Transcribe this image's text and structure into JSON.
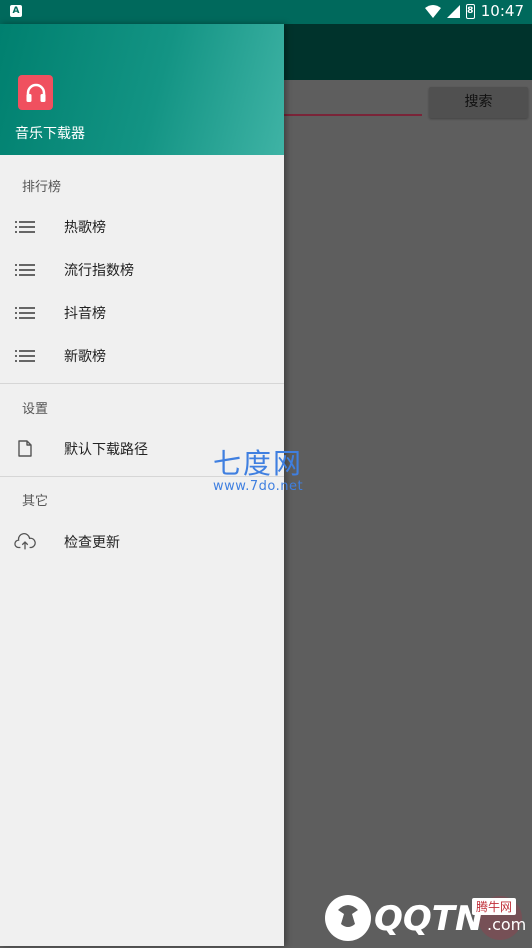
{
  "status_bar": {
    "time": "10:47",
    "battery_text": "8"
  },
  "background": {
    "search_button": "搜索"
  },
  "drawer": {
    "app_name": "音乐下载器",
    "sections": [
      {
        "title": "排行榜",
        "items": [
          {
            "label": "热歌榜",
            "icon": "list-icon"
          },
          {
            "label": "流行指数榜",
            "icon": "list-icon"
          },
          {
            "label": "抖音榜",
            "icon": "list-icon"
          },
          {
            "label": "新歌榜",
            "icon": "list-icon"
          }
        ]
      },
      {
        "title": "设置",
        "items": [
          {
            "label": "默认下载路径",
            "icon": "file-icon"
          }
        ]
      },
      {
        "title": "其它",
        "items": [
          {
            "label": "检查更新",
            "icon": "cloud-upload-icon"
          }
        ]
      }
    ]
  },
  "watermark": {
    "title": "七度网",
    "url": "www.7do.net"
  },
  "corner_badge": {
    "brand": "QQTN",
    "suffix": ".com",
    "tag": "腾牛网"
  },
  "colors": {
    "status_bar": "#00695c",
    "header_start": "#00806f",
    "header_end": "#3fb3a5",
    "logo": "#f0505f",
    "scrim": "#5e5e5e"
  }
}
